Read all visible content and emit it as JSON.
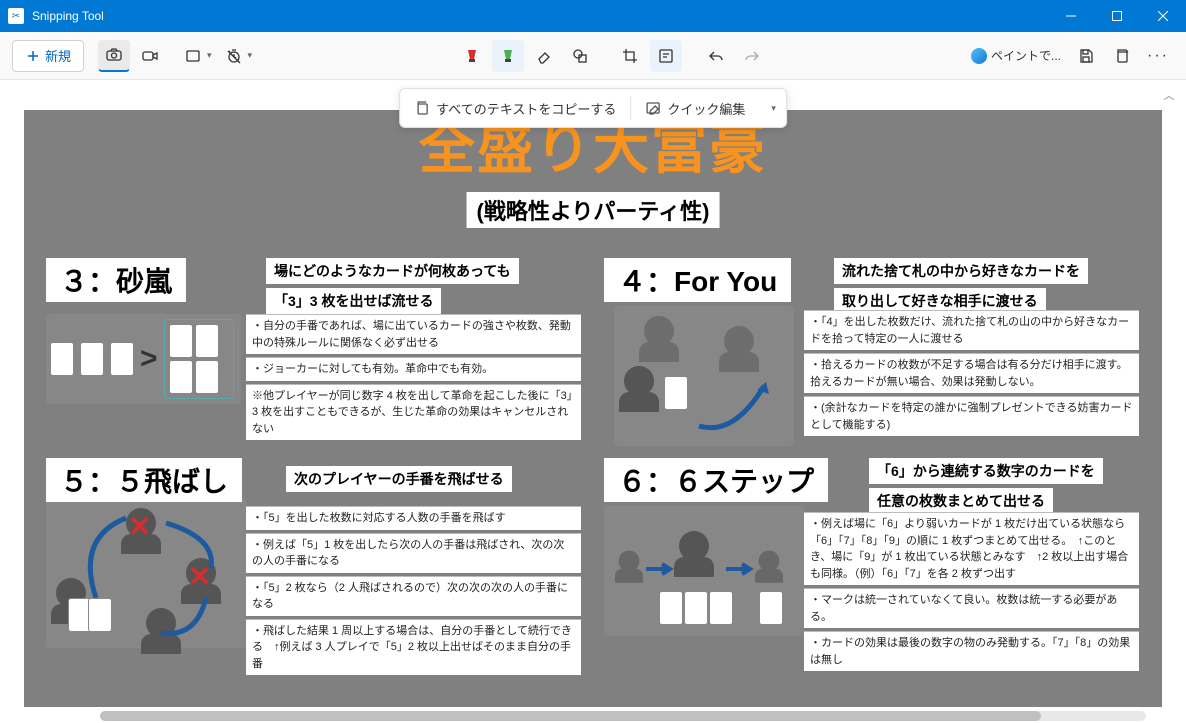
{
  "window": {
    "title": "Snipping Tool"
  },
  "toolbar": {
    "new_label": "新規",
    "paint_label": "ペイントで..."
  },
  "floatbar": {
    "copy_all_text": "すべてのテキストをコピーする",
    "quick_edit": "クイック編集"
  },
  "capture": {
    "main_title": "全盛り大富豪",
    "subtitle": "(戦略性よりパーティ性)",
    "rules": {
      "r3": {
        "heading": "３：砂嵐",
        "lead1": "場にどのようなカードが何枚あっても",
        "lead2": "「3」3 枚を出せば流せる",
        "bullets": [
          "・自分の手番であれば、場に出ているカードの強さや枚数、発動中の特殊ルールに関係なく必ず出せる",
          "・ジョーカーに対しても有効。革命中でも有効。",
          "※他プレイヤーが同じ数字 4 枚を出して革命を起こした後に「3」3 枚を出すこともできるが、生じた革命の効果はキャンセルされない"
        ]
      },
      "r4": {
        "heading": "４：For You",
        "lead1": "流れた捨て札の中から好きなカードを",
        "lead2": "取り出して好きな相手に渡せる",
        "bullets": [
          "・「4」を出した枚数だけ、流れた捨て札の山の中から好きなカードを拾って特定の一人に渡せる",
          "・拾えるカードの枚数が不足する場合は有る分だけ相手に渡す。拾えるカードが無い場合、効果は発動しない。",
          "・(余計なカードを特定の誰かに強制プレゼントできる妨害カードとして機能する)"
        ]
      },
      "r5": {
        "heading": "５：５飛ばし",
        "lead1": "次のプレイヤーの手番を飛ばせる",
        "bullets": [
          "・「5」を出した枚数に対応する人数の手番を飛ばす",
          "・例えば「5」1 枚を出したら次の人の手番は飛ばされ、次の次の人の手番になる",
          "・「5」2 枚なら（2 人飛ばされるので）次の次の次の人の手番になる",
          "・飛ばした結果 1 周以上する場合は、自分の手番として続行できる　↑例えば 3 人プレイで「5」2 枚以上出せばそのまま自分の手番"
        ]
      },
      "r6": {
        "heading": "６：６ステップ",
        "lead1": "「6」から連続する数字のカードを",
        "lead2": "任意の枚数まとめて出せる",
        "bullets": [
          "・例えば場に「6」より弱いカードが 1 枚だけ出ている状態なら「6」「7」「8」「9」の順に 1 枚ずつまとめて出せる。　↑このとき、場に「9」が 1 枚出ている状態とみなす　↑2 枚以上出す場合も同様。（例）「6」「7」を各 2 枚ずつ出す",
          "・マークは統一されていなくて良い。枚数は統一する必要がある。",
          "・カードの効果は最後の数字の物のみ発動する。「7」「8」の効果は無し"
        ]
      }
    }
  }
}
